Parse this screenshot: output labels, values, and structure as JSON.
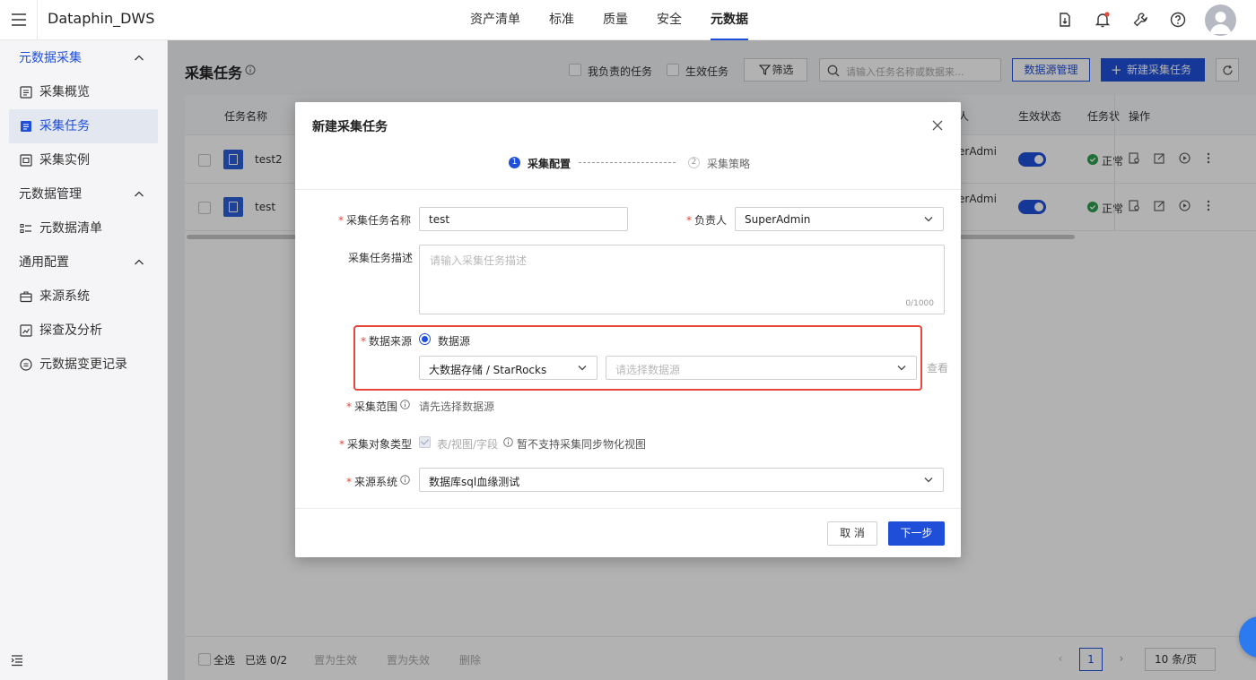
{
  "app": {
    "title": "Dataphin_DWS"
  },
  "topnav": {
    "items": [
      "资产清单",
      "标准",
      "质量",
      "安全",
      "元数据"
    ],
    "active": "元数据"
  },
  "sidebar": {
    "groups": [
      {
        "label": "元数据采集",
        "items": [
          "采集概览",
          "采集任务",
          "采集实例"
        ]
      },
      {
        "label": "元数据管理",
        "items": [
          "元数据清单"
        ]
      },
      {
        "label": "通用配置",
        "items": [
          "来源系统",
          "探查及分析",
          "元数据变更记录"
        ]
      }
    ],
    "active_item": "采集任务"
  },
  "page": {
    "title": "采集任务",
    "filter_mine": "我负责的任务",
    "filter_active": "生效任务",
    "filter_button": "筛选",
    "search_placeholder": "请输入任务名称或数据来...",
    "datasource_mgmt": "数据源管理",
    "new_task": "新建采集任务"
  },
  "table": {
    "headers": {
      "name": "任务名称",
      "owner_partial": "人",
      "status": "生效状态",
      "task_status_partial": "任务状",
      "actions": "操作"
    },
    "rows": [
      {
        "name": "test2",
        "owner_partial": "erAdmi",
        "status_partial": "正常"
      },
      {
        "name": "test",
        "owner_partial": "erAdmi",
        "status_partial": "正常"
      }
    ]
  },
  "footer": {
    "select_all": "全选",
    "selected": "已选 0/2",
    "set_active": "置为生效",
    "set_inactive": "置为失效",
    "delete": "删除",
    "page": "1",
    "page_size": "10 条/页"
  },
  "modal": {
    "title": "新建采集任务",
    "steps": [
      {
        "num": "1",
        "label": "采集配置"
      },
      {
        "num": "2",
        "label": "采集策略"
      }
    ],
    "fields": {
      "name_label": "采集任务名称",
      "name_value": "test",
      "owner_label": "负责人",
      "owner_value": "SuperAdmin",
      "desc_label": "采集任务描述",
      "desc_placeholder": "请输入采集任务描述",
      "desc_count": "0/1000",
      "source_label": "数据来源",
      "source_radio": "数据源",
      "source_type_value": "大数据存储 / StarRocks",
      "source_select_placeholder": "请选择数据源",
      "view_link": "查看",
      "scope_label": "采集范围",
      "scope_hint": "请先选择数据源",
      "objtype_label": "采集对象类型",
      "objtype_value": "表/视图/字段",
      "objtype_note": "暂不支持采集同步物化视图",
      "system_label": "来源系统",
      "system_value": "数据库sql血缘测试"
    },
    "cancel": "取 消",
    "next": "下一步"
  }
}
